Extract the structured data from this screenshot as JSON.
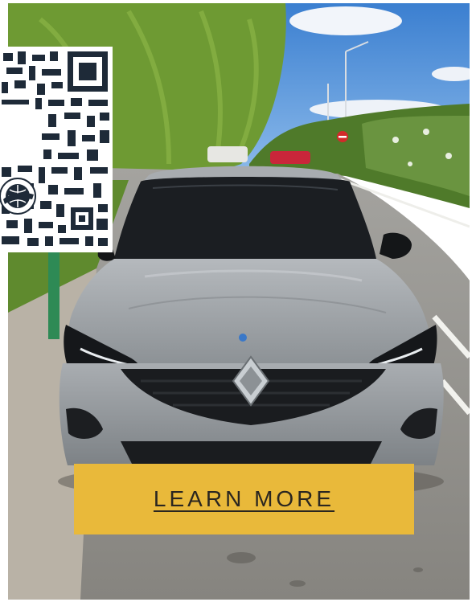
{
  "photo": {
    "subject": "silver-hatchback-front-view",
    "colors": {
      "sky": "#4d8fd6",
      "foliage": "#5f8a2e",
      "road": "#8f8f8c",
      "car_body": "#9ea2a5",
      "sidewalk": "#b9b2a6"
    }
  },
  "qr": {
    "icon": "qr-code-icon",
    "logo": "globe-car-logo"
  },
  "cta": {
    "label": "LEARN MORE",
    "color": "#e9b93a"
  }
}
